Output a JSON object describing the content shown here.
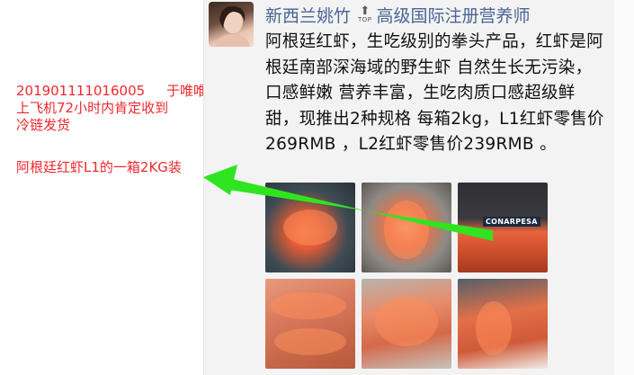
{
  "annotation": {
    "line1": "201901111016005",
    "line1_suffix": "于唯唯",
    "line2": "上飞机72小时内肯定收到",
    "line3": "冷链发货",
    "line4": "阿根廷红虾L1的一箱2KG装"
  },
  "post": {
    "author": "新西兰姚竹",
    "top_badge_text": "TOP",
    "author_title": "高级国际注册营养师",
    "text": "阿根廷红虾，生吃级别的拳头产品，红虾是阿根廷南部深海域的野生虾 自然生长无污染，口感鲜嫩 营养丰富，生吃肉质口感超级鲜甜，现推出2种规格 每箱2kg，L1红虾零售价269RMB ，L2红虾零售价239RMB 。",
    "photo_brand_label": "CONARPESA"
  },
  "colors": {
    "annotation_red": "#f0282d",
    "arrow_green": "#2ee51f",
    "name_blue": "#4a6593"
  }
}
